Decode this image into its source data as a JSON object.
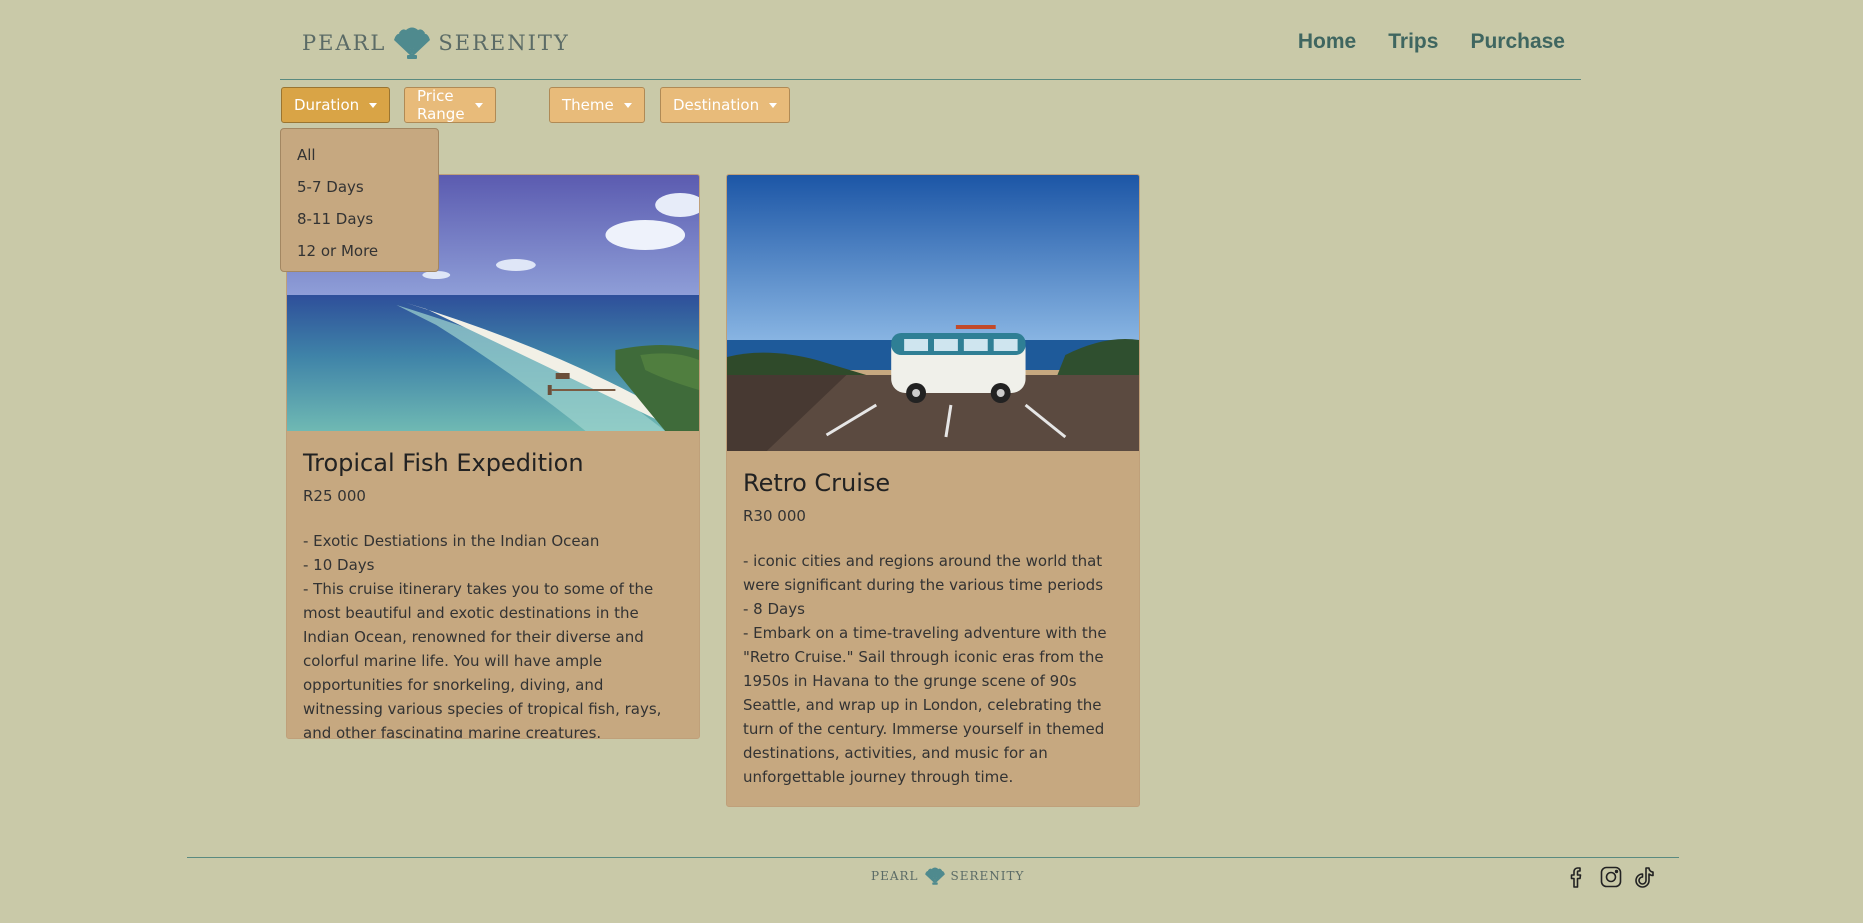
{
  "brand": {
    "word1": "PEARL",
    "word2": "SERENITY"
  },
  "nav": {
    "home": "Home",
    "trips": "Trips",
    "purchase": "Purchase"
  },
  "filters": {
    "duration": "Duration",
    "price_range": "Price Range",
    "theme": "Theme",
    "destination": "Destination"
  },
  "dropdown": {
    "items": [
      "All",
      "5-7 Days",
      "8-11 Days",
      "12 or More"
    ]
  },
  "cards": [
    {
      "title": "Tropical Fish Expedition",
      "price": "R25 000",
      "description": "- Exotic Destiations in the Indian Ocean\n- 10 Days\n- This cruise itinerary takes you to some of the most beautiful and exotic destinations in the Indian Ocean, renowned for their diverse and colorful marine life. You will have ample opportunities for snorkeling, diving, and witnessing various species of tropical fish, rays, and other fascinating marine creatures."
    },
    {
      "title": "Retro Cruise",
      "price": "R30 000",
      "description": "- iconic cities and regions around the world that were significant during the various time periods\n- 8 Days\n- Embark on a time-traveling adventure with the \"Retro Cruise.\" Sail through iconic eras from the 1950s in Havana to the grunge scene of 90s Seattle, and wrap up in London, celebrating the turn of the century. Immerse yourself in themed destinations, activities, and music for an unforgettable journey through time."
    }
  ],
  "colors": {
    "background": "#c9c9a8",
    "card": "#c6a880",
    "filter_button": "#e8bb7a",
    "filter_button_active": "#d9a446",
    "nav_text": "#3f6660",
    "rule": "#5a8a80"
  },
  "icons": {
    "logo": "seashell-icon",
    "socials": [
      "facebook-icon",
      "instagram-icon",
      "tiktok-icon"
    ]
  }
}
